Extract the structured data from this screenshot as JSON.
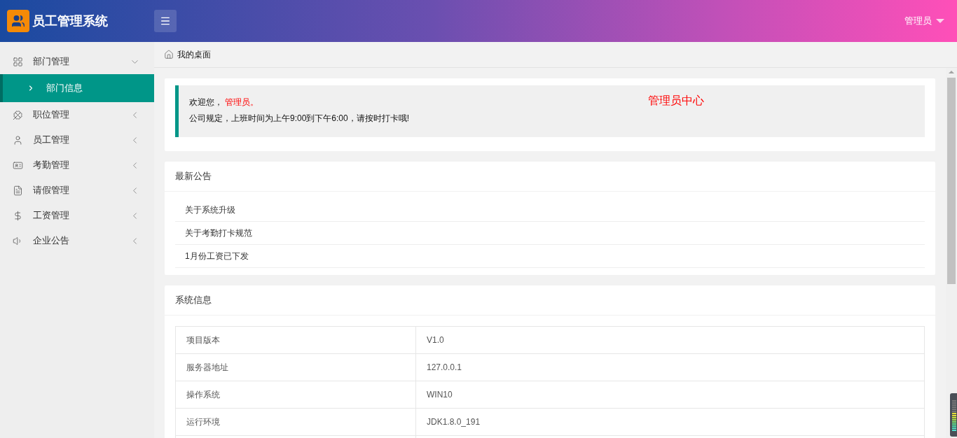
{
  "header": {
    "logo_title": "员工管理系统",
    "user": "管理员"
  },
  "sidebar": {
    "items": [
      {
        "label": "部门管理",
        "expanded": true,
        "children": [
          {
            "label": "部门信息",
            "selected": true
          }
        ]
      },
      {
        "label": "职位管理",
        "expanded": false
      },
      {
        "label": "员工管理",
        "expanded": false
      },
      {
        "label": "考勤管理",
        "expanded": false
      },
      {
        "label": "请假管理",
        "expanded": false
      },
      {
        "label": "工资管理",
        "expanded": false
      },
      {
        "label": "企业公告",
        "expanded": false
      }
    ]
  },
  "breadcrumb": "我的桌面",
  "welcome": {
    "greeting": "欢迎您，",
    "name": "管理员。",
    "rule": "公司规定，上班时间为上午9:00到下午6:00，请按时打卡哦!",
    "center_title": "管理员中心"
  },
  "notices": {
    "title": "最新公告",
    "items": [
      "关于系统升级",
      "关于考勤打卡规范",
      "1月份工资已下发"
    ]
  },
  "system_info": {
    "title": "系统信息",
    "rows": [
      {
        "label": "项目版本",
        "value": "V1.0"
      },
      {
        "label": "服务器地址",
        "value": "127.0.0.1"
      },
      {
        "label": "操作系统",
        "value": "WIN10"
      },
      {
        "label": "运行环境",
        "value": "JDK1.8.0_191"
      }
    ]
  }
}
